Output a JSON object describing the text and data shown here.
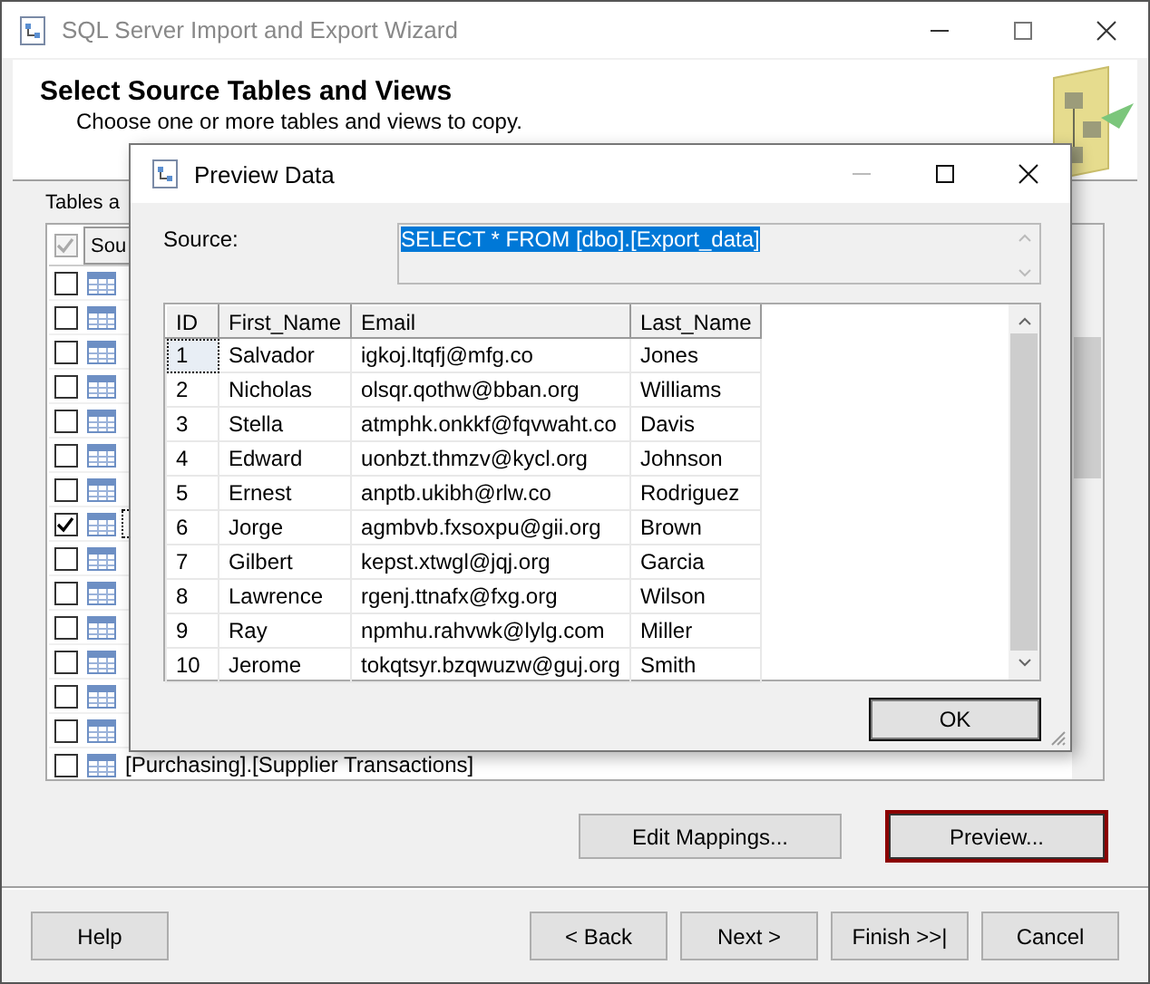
{
  "window": {
    "title": "SQL Server Import and Export Wizard"
  },
  "header": {
    "title": "Select Source Tables and Views",
    "subtitle": "Choose one or more tables and views to copy."
  },
  "tables_label": "Tables a",
  "tables": {
    "columns": [
      "Sou"
    ],
    "all_checked": true,
    "rows": [
      {
        "checked": false
      },
      {
        "checked": false
      },
      {
        "checked": false
      },
      {
        "checked": false
      },
      {
        "checked": false
      },
      {
        "checked": false
      },
      {
        "checked": false
      },
      {
        "checked": true
      },
      {
        "checked": false
      },
      {
        "checked": false
      },
      {
        "checked": false
      },
      {
        "checked": false
      },
      {
        "checked": false
      },
      {
        "checked": false
      },
      {
        "checked": false,
        "source": "[Purchasing].[Supplier Transactions]"
      }
    ]
  },
  "actions": [
    {
      "label": "Edit Mappings...",
      "focused": false
    },
    {
      "label": "Preview...",
      "focused": true
    }
  ],
  "footer_buttons": [
    {
      "label": "Help",
      "kind": "help"
    },
    {
      "label": "< Back",
      "kind": "nav"
    },
    {
      "label": "Next >",
      "kind": "nav"
    },
    {
      "label": "Finish >>|",
      "kind": "nav"
    },
    {
      "label": "Cancel",
      "kind": "nav"
    }
  ],
  "dialog": {
    "title": "Preview Data",
    "source_label": "Source:",
    "source_value": "SELECT * FROM [dbo].[Export_data]",
    "columns": [
      "ID",
      "First_Name",
      "Email",
      "Last_Name"
    ],
    "rows": [
      [
        "1",
        "Salvador",
        "igkoj.ltqfj@mfg.co",
        "Jones"
      ],
      [
        "2",
        "Nicholas",
        "olsqr.qothw@bban.org",
        "Williams"
      ],
      [
        "3",
        "Stella",
        "atmphk.onkkf@fqvwaht.co",
        "Davis"
      ],
      [
        "4",
        "Edward",
        "uonbzt.thmzv@kycl.org",
        "Johnson"
      ],
      [
        "5",
        "Ernest",
        "anptb.ukibh@rlw.co",
        "Rodriguez"
      ],
      [
        "6",
        "Jorge",
        "agmbvb.fxsoxpu@gii.org",
        "Brown"
      ],
      [
        "7",
        "Gilbert",
        "kepst.xtwgl@jqj.org",
        "Garcia"
      ],
      [
        "8",
        "Lawrence",
        "rgenj.ttnafx@fxg.org",
        "Wilson"
      ],
      [
        "9",
        "Ray",
        "npmhu.rahvwk@lylg.com",
        "Miller"
      ],
      [
        "10",
        "Jerome",
        "tokqtsyr.bzqwuzw@guj.org",
        "Smith"
      ]
    ],
    "ok": "OK"
  }
}
